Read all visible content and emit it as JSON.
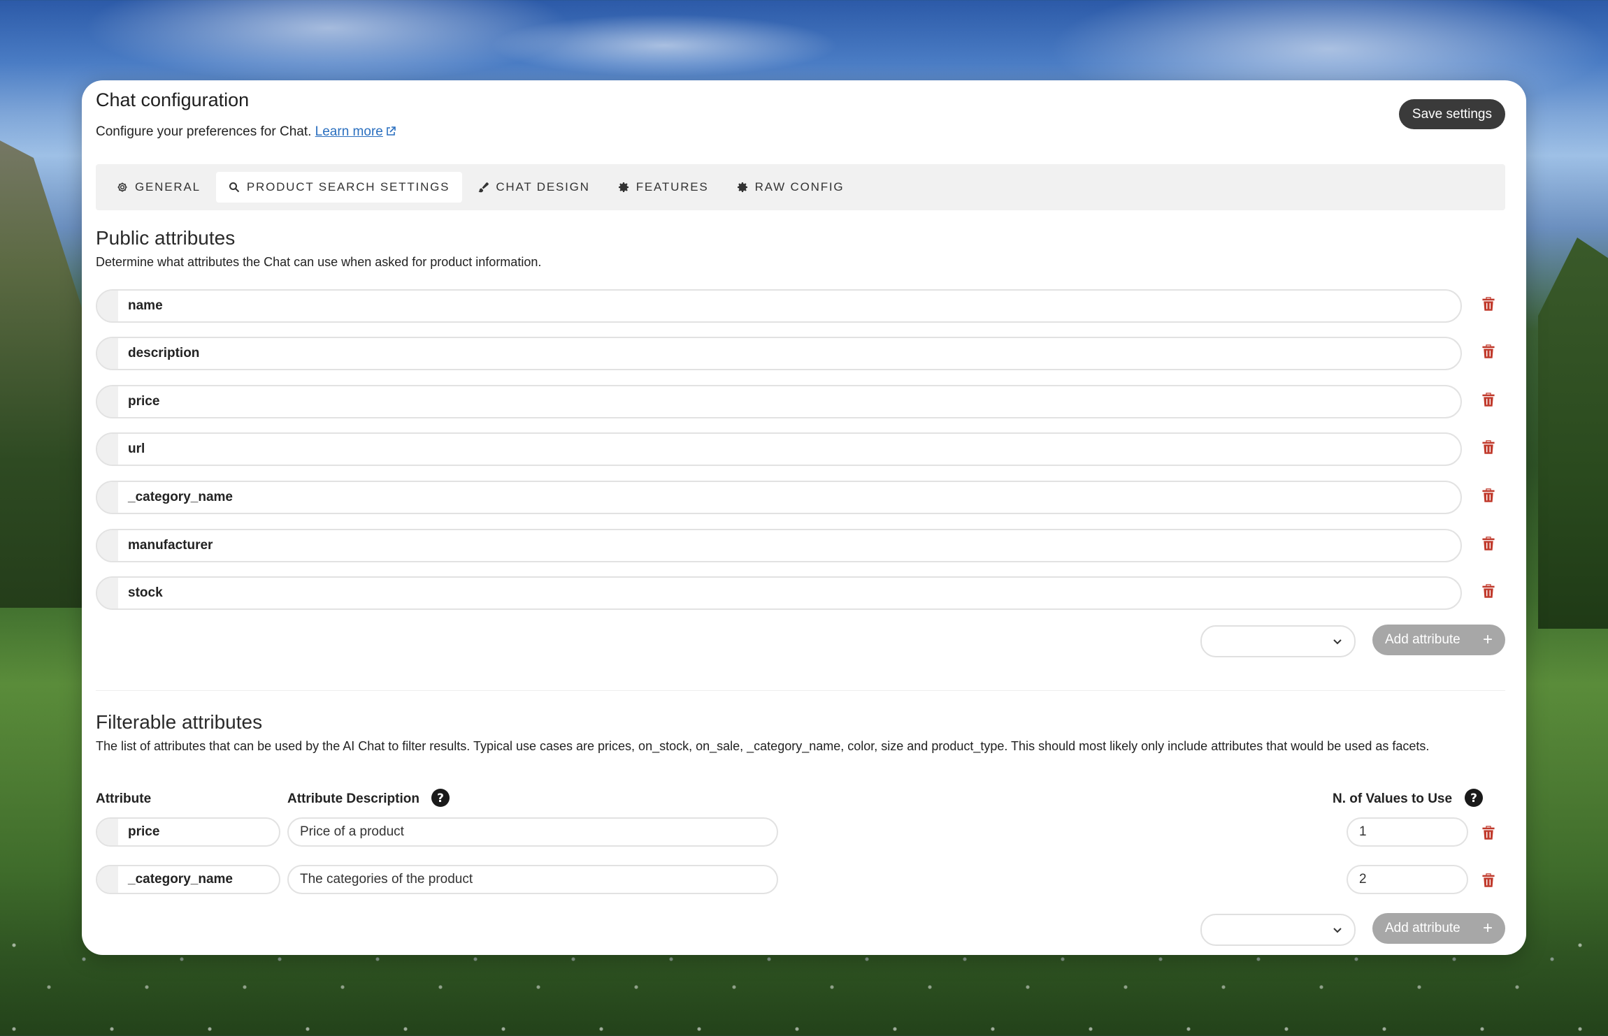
{
  "header": {
    "title": "Chat configuration",
    "subtitle": "Configure your preferences for Chat.",
    "learn_more": "Learn more",
    "save_label": "Save settings"
  },
  "tabs": [
    {
      "label": "GENERAL",
      "icon": "gear-icon"
    },
    {
      "label": "PRODUCT SEARCH SETTINGS",
      "icon": "search-icon",
      "active": true
    },
    {
      "label": "CHAT DESIGN",
      "icon": "brush-icon"
    },
    {
      "label": "FEATURES",
      "icon": "cog-icon"
    },
    {
      "label": "RAW CONFIG",
      "icon": "cog-icon"
    }
  ],
  "public_attributes": {
    "title": "Public attributes",
    "description": "Determine what attributes the Chat can use when asked for product information.",
    "items": [
      "name",
      "description",
      "price",
      "url",
      "_category_name",
      "manufacturer",
      "stock"
    ],
    "add_label": "Add attribute",
    "select_value": ""
  },
  "filterable_attributes": {
    "title": "Filterable attributes",
    "description": "The list of attributes that can be used by the AI Chat to filter results. Typical use cases are prices, on_stock, on_sale, _category_name, color, size and product_type. This should most likely only include attributes that would be used as facets.",
    "col_attribute": "Attribute",
    "col_description": "Attribute Description",
    "col_values": "N. of Values to Use",
    "rows": [
      {
        "attribute": "price",
        "description": "Price of a product",
        "values": "1"
      },
      {
        "attribute": "_category_name",
        "description": "The categories of the product",
        "values": "2"
      }
    ],
    "add_label": "Add attribute",
    "select_value": ""
  },
  "colors": {
    "primary_button": "#3a3a3a",
    "disabled_button": "#a7a7a7",
    "link": "#2a6fbf",
    "trash": "#c0392b"
  }
}
